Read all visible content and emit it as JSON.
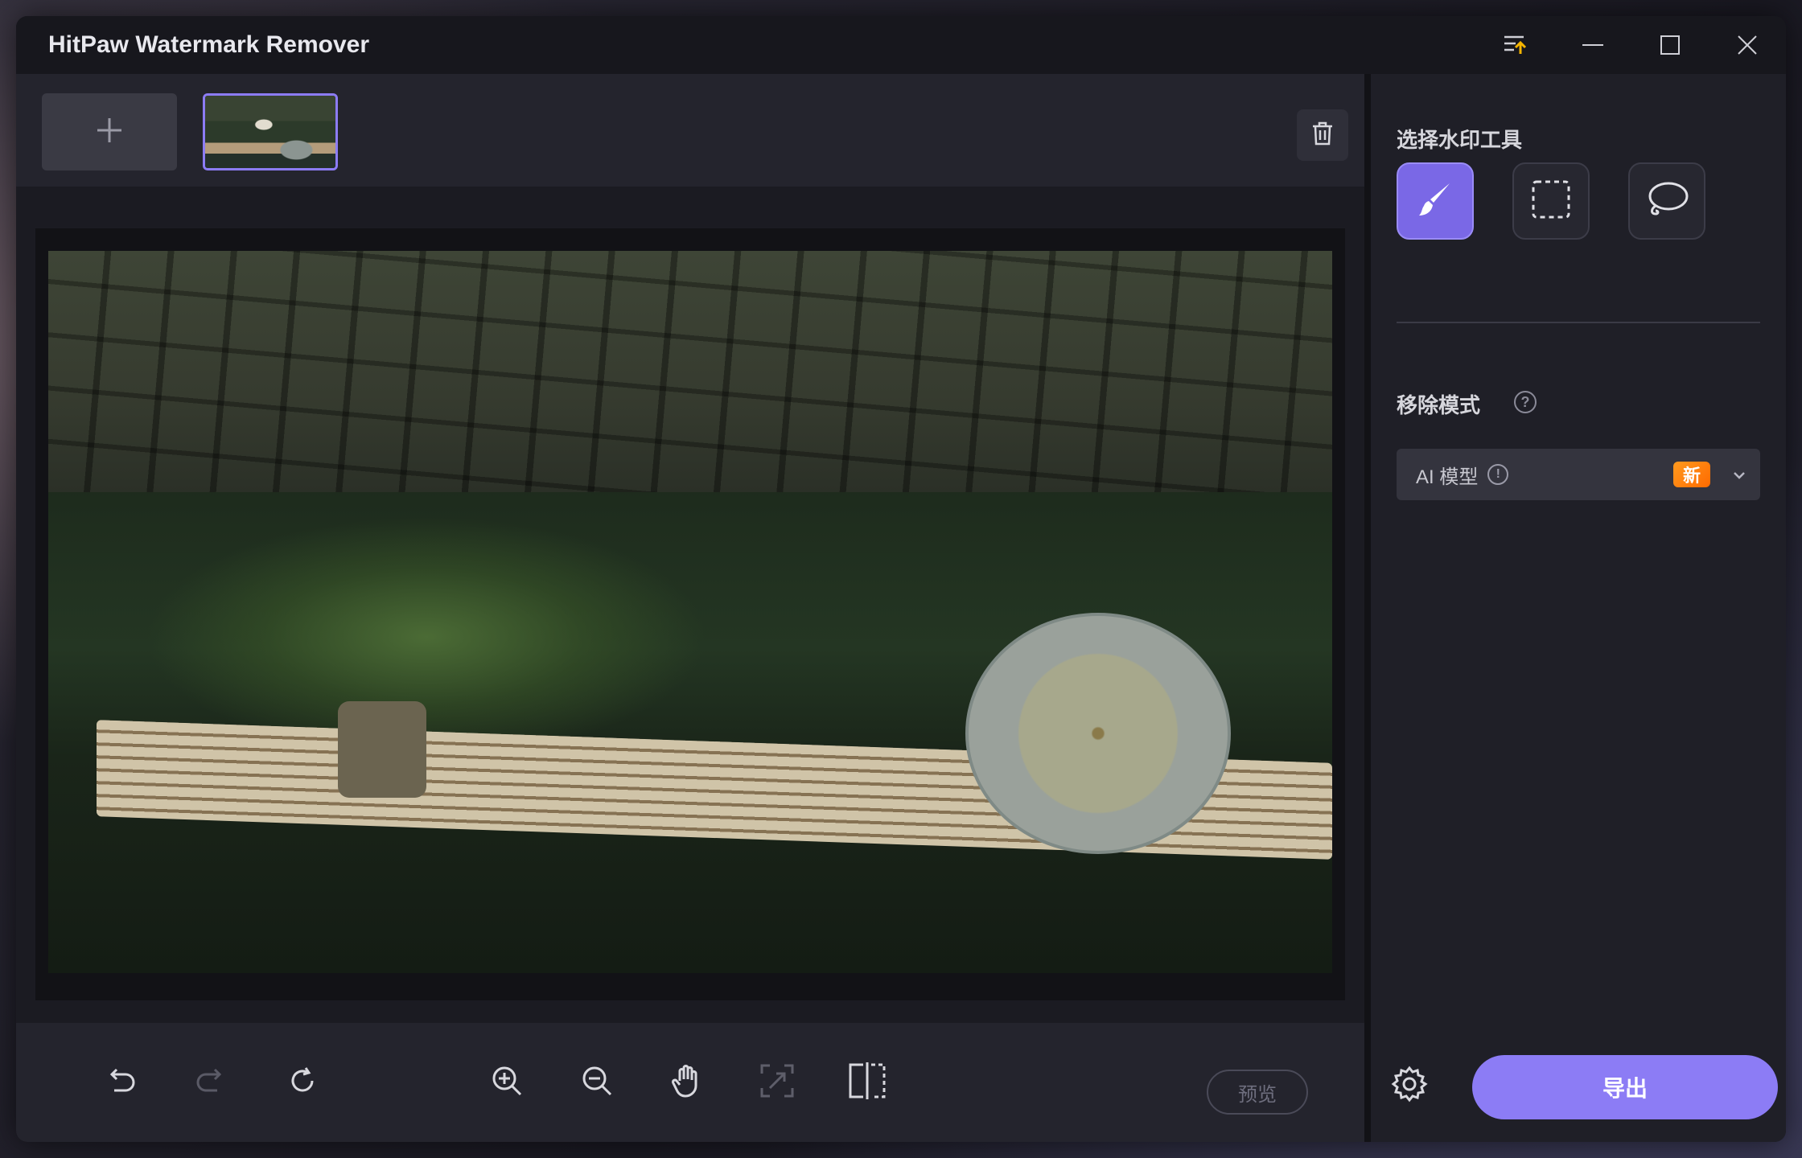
{
  "window": {
    "title": "HitPaw Watermark Remover",
    "controls": [
      "queue-icon",
      "minimize-icon",
      "maximize-icon",
      "close-icon"
    ]
  },
  "thumbnails": {
    "add_icon": "plus-icon",
    "items": [
      {
        "selected": true
      }
    ],
    "delete_icon": "trash-icon"
  },
  "toolbar": {
    "undo_icon": "undo-icon",
    "redo_icon": "redo-icon",
    "reset_icon": "reset-icon",
    "zoom_in_icon": "zoom-in-icon",
    "zoom_out_icon": "zoom-out-icon",
    "pan_icon": "hand-icon",
    "fit_icon": "fit-screen-icon",
    "compare_icon": "compare-icon",
    "preview_label": "预览"
  },
  "side_panel": {
    "tool_section_title": "选择水印工具",
    "tools": [
      {
        "name": "brush-tool",
        "icon": "brush-icon",
        "active": true
      },
      {
        "name": "rectangle-tool",
        "icon": "rect-select-icon",
        "active": false
      },
      {
        "name": "lasso-tool",
        "icon": "lasso-icon",
        "active": false
      }
    ],
    "mode_section_title": "移除模式",
    "mode_value": "AI 模型",
    "mode_badge": "新",
    "export_label": "导出"
  },
  "colors": {
    "accent": "#8c7cf5",
    "badge": "#ff7a00",
    "background": "#1b1b22"
  }
}
